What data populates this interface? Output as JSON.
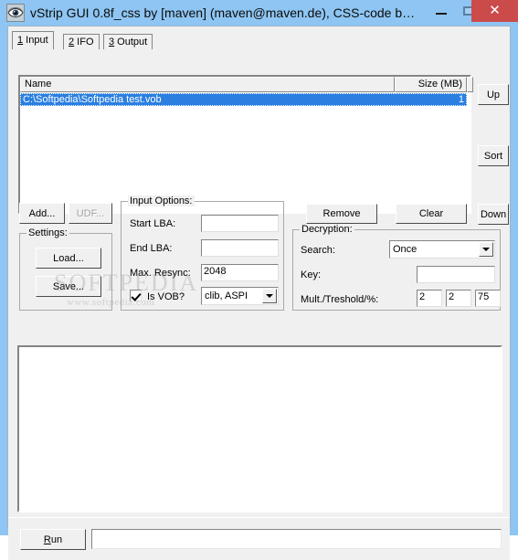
{
  "window": {
    "title": "vStrip GUI 0.8f_css by [maven] (maven@maven.de), CSS-code b…",
    "icon": "eye-icon",
    "minimize_label": "–",
    "maximize_label": "□",
    "close_label": "✕",
    "titlebar_color": "#8ec5f2",
    "close_button_color": "#cb4b4b",
    "client_bg": "#f0f0f0"
  },
  "tabs": [
    {
      "mnemonic": "1",
      "label": " Input",
      "active": true
    },
    {
      "mnemonic": "2",
      "label": " IFO",
      "active": false
    },
    {
      "mnemonic": "3",
      "label": " Output",
      "active": false
    }
  ],
  "file_list": {
    "columns": [
      "Name",
      "Size (MB)"
    ],
    "rows": [
      {
        "name": "C:\\Softpedia\\Softpedia test.vob",
        "size": "1",
        "selected": true
      }
    ],
    "selection_color": "#2a7fe0"
  },
  "side_buttons": [
    {
      "label": "Up"
    },
    {
      "label": "Sort"
    },
    {
      "label": "Down"
    }
  ],
  "action_buttons": {
    "add": "Add...",
    "udf": "UDF...",
    "remove": "Remove",
    "clear": "Clear"
  },
  "settings_group": {
    "title": "Settings:",
    "load": "Load...",
    "save": "Save..."
  },
  "input_options": {
    "title": "Input Options:",
    "start_lba_label": "Start LBA:",
    "start_lba_value": "",
    "end_lba_label": "End LBA:",
    "end_lba_value": "",
    "max_resync_label": "Max. Resync:",
    "max_resync_value": "2048",
    "is_vob_label": "Is VOB?",
    "is_vob_checked": true,
    "reader_selected": "clib, ASPI",
    "reader_options": [
      "clib, ASPI"
    ]
  },
  "decryption": {
    "title": "Decryption:",
    "search_label": "Search:",
    "search_selected": "Once",
    "search_options": [
      "Once"
    ],
    "key_label": "Key:",
    "key_value": "",
    "mult_label": "Mult./Treshold/%:",
    "mult_value": "2",
    "threshold_value": "2",
    "percent_value": "75"
  },
  "log": {
    "content": ""
  },
  "bottom": {
    "run_mnemonic": "R",
    "run_label": "un",
    "progress_text": ""
  },
  "watermark": {
    "main": "SOFTPEDIA",
    "registered": "®",
    "sub": "www.softpedia.com"
  }
}
